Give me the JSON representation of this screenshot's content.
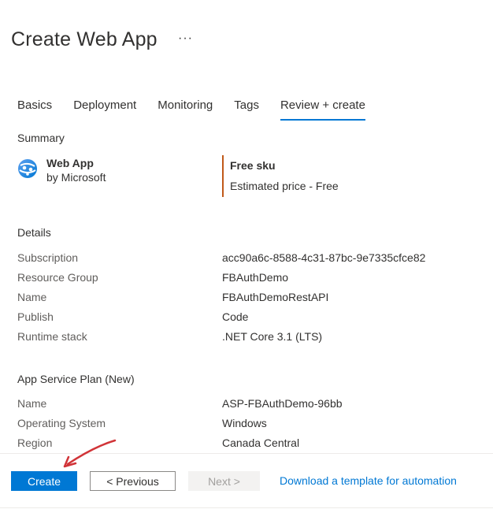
{
  "header": {
    "title": "Create Web App",
    "more": "···"
  },
  "tabs": [
    {
      "label": "Basics",
      "active": false
    },
    {
      "label": "Deployment",
      "active": false
    },
    {
      "label": "Monitoring",
      "active": false
    },
    {
      "label": "Tags",
      "active": false
    },
    {
      "label": "Review + create",
      "active": true
    }
  ],
  "summary": {
    "label": "Summary",
    "product_name": "Web App",
    "product_vendor": "by Microsoft",
    "product_icon": "web-app-icon",
    "sku_title": "Free sku",
    "sku_price": "Estimated price - Free",
    "sku_accent": "#c05919"
  },
  "details": {
    "title": "Details",
    "rows": [
      {
        "key": "Subscription",
        "value": "acc90a6c-8588-4c31-87bc-9e7335cfce82"
      },
      {
        "key": "Resource Group",
        "value": "FBAuthDemo"
      },
      {
        "key": "Name",
        "value": "FBAuthDemoRestAPI"
      },
      {
        "key": "Publish",
        "value": "Code"
      },
      {
        "key": "Runtime stack",
        "value": ".NET Core 3.1 (LTS)"
      }
    ]
  },
  "app_service_plan": {
    "title": "App Service Plan (New)",
    "rows": [
      {
        "key": "Name",
        "value": "ASP-FBAuthDemo-96bb"
      },
      {
        "key": "Operating System",
        "value": "Windows"
      },
      {
        "key": "Region",
        "value": "Canada Central"
      }
    ]
  },
  "footer": {
    "create_label": "Create",
    "previous_label": "< Previous",
    "next_label": "Next >",
    "template_link": "Download a template for automation"
  },
  "colors": {
    "accent": "#0078d4",
    "annotation": "#d13438"
  }
}
